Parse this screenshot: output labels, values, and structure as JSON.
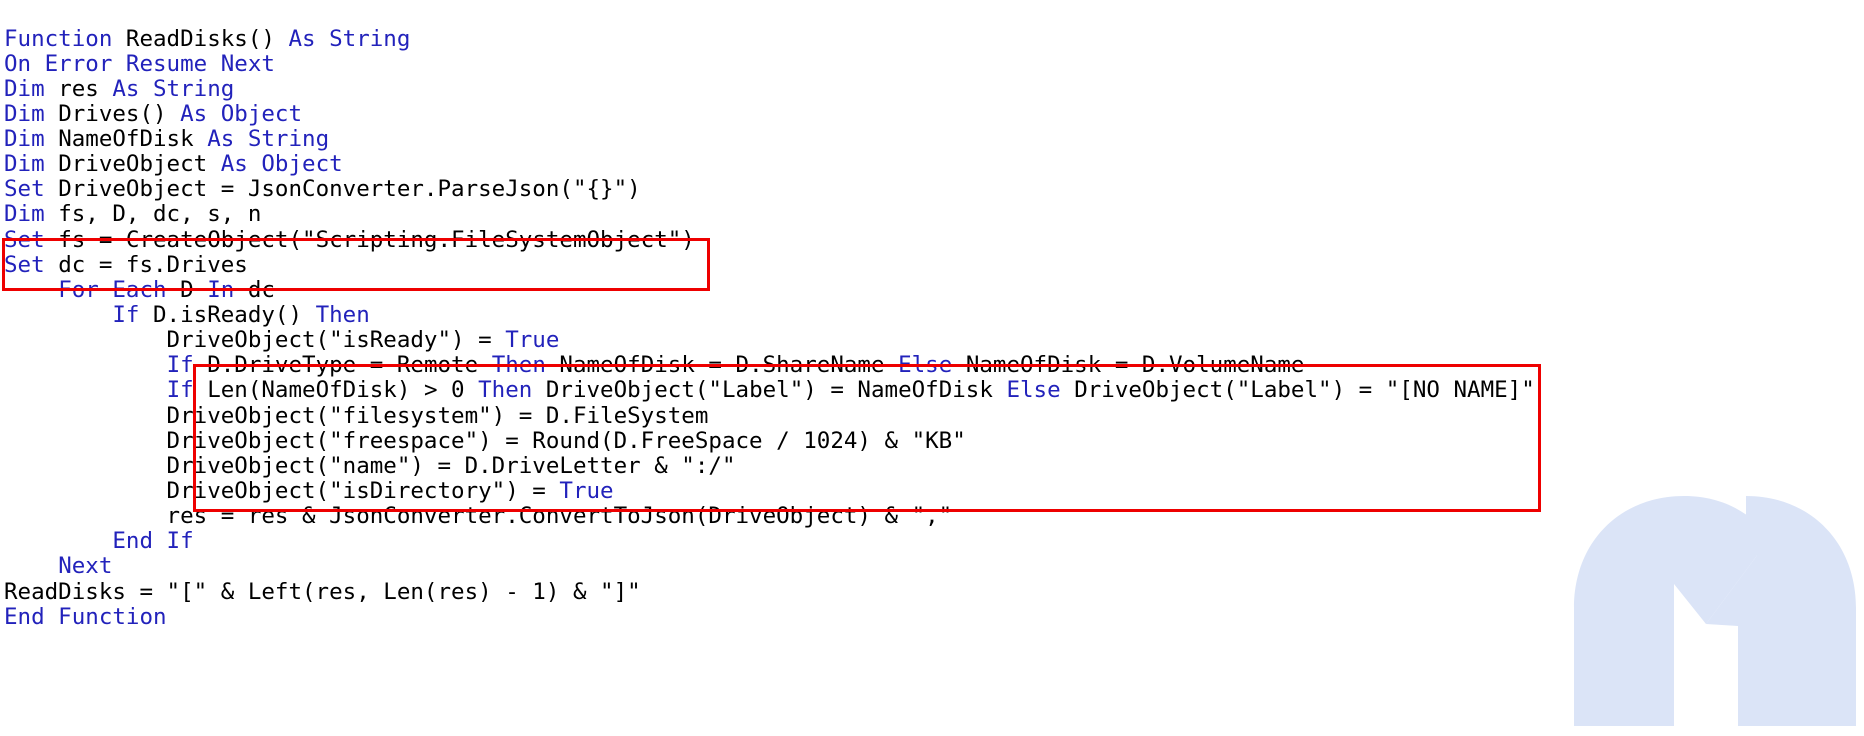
{
  "document": {
    "kind": "source-code-listing",
    "language": "VBA",
    "colors": {
      "background": "#ffffff",
      "keyword": "#2222bb",
      "identifier": "#000000",
      "annotation": "#ee0000",
      "watermark": "#dbe4f7"
    }
  },
  "watermark": {
    "name": "malwarebytes-m-logo",
    "color": "#dbe4f7"
  },
  "annotations": [
    {
      "name": "red-highlight-box-1",
      "label": "Highlighted lines: CreateObject FileSystemObject and fs.Drives",
      "color": "#ee0000"
    },
    {
      "name": "red-highlight-box-2",
      "label": "Highlighted lines: DriveObject property assignments and ConvertToJson",
      "color": "#ee0000"
    }
  ],
  "code": {
    "lines": [
      [
        {
          "t": "Function ",
          "k": true
        },
        {
          "t": "ReadDisks() ",
          "k": false
        },
        {
          "t": "As String",
          "k": true
        }
      ],
      [
        {
          "t": "On Error Resume Next",
          "k": true
        }
      ],
      [
        {
          "t": "Dim ",
          "k": true
        },
        {
          "t": "res ",
          "k": false
        },
        {
          "t": "As String",
          "k": true
        }
      ],
      [
        {
          "t": "Dim ",
          "k": true
        },
        {
          "t": "Drives() ",
          "k": false
        },
        {
          "t": "As Object",
          "k": true
        }
      ],
      [
        {
          "t": "Dim ",
          "k": true
        },
        {
          "t": "NameOfDisk ",
          "k": false
        },
        {
          "t": "As String",
          "k": true
        }
      ],
      [
        {
          "t": "Dim ",
          "k": true
        },
        {
          "t": "DriveObject ",
          "k": false
        },
        {
          "t": "As Object",
          "k": true
        }
      ],
      [
        {
          "t": "Set ",
          "k": true
        },
        {
          "t": "DriveObject = JsonConverter.ParseJson(\"{}\")",
          "k": false
        }
      ],
      [
        {
          "t": "Dim ",
          "k": true
        },
        {
          "t": "fs, D, dc, s, n",
          "k": false
        }
      ],
      [
        {
          "t": "Set ",
          "k": true
        },
        {
          "t": "fs = CreateObject(\"Scripting.FileSystemObject\")",
          "k": false
        }
      ],
      [
        {
          "t": "Set ",
          "k": true
        },
        {
          "t": "dc = fs.Drives",
          "k": false
        }
      ],
      [
        {
          "t": "    ",
          "k": false
        },
        {
          "t": "For Each ",
          "k": true
        },
        {
          "t": "D ",
          "k": false
        },
        {
          "t": "In ",
          "k": true
        },
        {
          "t": "dc",
          "k": false
        }
      ],
      [
        {
          "t": "        ",
          "k": false
        },
        {
          "t": "If ",
          "k": true
        },
        {
          "t": "D.isReady() ",
          "k": false
        },
        {
          "t": "Then",
          "k": true
        }
      ],
      [
        {
          "t": "            DriveObject(\"isReady\") = ",
          "k": false
        },
        {
          "t": "True",
          "k": true
        }
      ],
      [
        {
          "t": "            ",
          "k": false
        },
        {
          "t": "If ",
          "k": true
        },
        {
          "t": "D.DriveType = Remote ",
          "k": false
        },
        {
          "t": "Then ",
          "k": true
        },
        {
          "t": "NameOfDisk = D.ShareName ",
          "k": false
        },
        {
          "t": "Else ",
          "k": true
        },
        {
          "t": "NameOfDisk = D.VolumeName",
          "k": false
        }
      ],
      [
        {
          "t": "            ",
          "k": false
        },
        {
          "t": "If ",
          "k": true
        },
        {
          "t": "Len(NameOfDisk) > 0 ",
          "k": false
        },
        {
          "t": "Then ",
          "k": true
        },
        {
          "t": "DriveObject(\"Label\") = NameOfDisk ",
          "k": false
        },
        {
          "t": "Else ",
          "k": true
        },
        {
          "t": "DriveObject(\"Label\") = \"[NO NAME]\"",
          "k": false
        }
      ],
      [
        {
          "t": "            DriveObject(\"filesystem\") = D.FileSystem",
          "k": false
        }
      ],
      [
        {
          "t": "            DriveObject(\"freespace\") = Round(D.FreeSpace / 1024) & \"KB\"",
          "k": false
        }
      ],
      [
        {
          "t": "            DriveObject(\"name\") = D.DriveLetter & \":/\"",
          "k": false
        }
      ],
      [
        {
          "t": "            DriveObject(\"isDirectory\") = ",
          "k": false
        },
        {
          "t": "True",
          "k": true
        }
      ],
      [
        {
          "t": "            res = res & JsonConverter.ConvertToJson(DriveObject) & \",\"",
          "k": false
        }
      ],
      [
        {
          "t": "        ",
          "k": false
        },
        {
          "t": "End If",
          "k": true
        }
      ],
      [
        {
          "t": "    ",
          "k": false
        },
        {
          "t": "Next",
          "k": true
        }
      ],
      [
        {
          "t": "ReadDisks = \"[\" & Left(res, Len(res) - 1) & \"]\"",
          "k": false
        }
      ],
      [
        {
          "t": "End Function",
          "k": true
        }
      ]
    ]
  }
}
